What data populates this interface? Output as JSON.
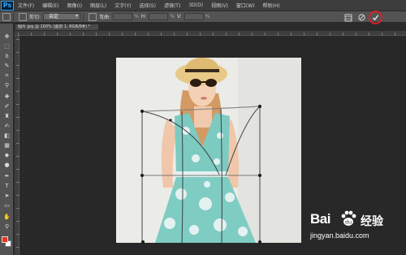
{
  "app": {
    "logo_text": "Ps"
  },
  "menu": {
    "items": [
      "文件(F)",
      "编辑(E)",
      "图像(I)",
      "图层(L)",
      "文字(Y)",
      "选择(S)",
      "滤镜(T)",
      "3D(D)",
      "视图(V)",
      "窗口(W)",
      "帮助(H)"
    ]
  },
  "options_bar": {
    "crop_label": "剪切:",
    "warp_mode_value": "自定",
    "bend_label": "弯曲:",
    "h_label": "H:",
    "v_label": "V:",
    "percent_unit": "%"
  },
  "document_tab": {
    "title": "图片.jpg @ 100% (图层 1, RGB/8#) *"
  },
  "colors": {
    "foreground": "#e8321e",
    "background": "#ffffff",
    "confirm_highlight": "#d6202a"
  },
  "watermark": {
    "brand": "Bai",
    "paw_glyph": "du",
    "chinese": "经验",
    "url": "jingyan.baidu.com"
  },
  "icons": [
    "move-icon",
    "marquee-icon",
    "lasso-icon",
    "quick-select-icon",
    "crop-icon",
    "eyedropper-icon",
    "heal-icon",
    "brush-icon",
    "stamp-icon",
    "history-brush-icon",
    "eraser-icon",
    "gradient-icon",
    "blur-icon",
    "dodge-icon",
    "pen-icon",
    "type-icon",
    "path-select-icon",
    "shape-icon",
    "hand-icon",
    "zoom-icon",
    "cancel-icon",
    "confirm-icon",
    "warp-toggle-icon"
  ]
}
